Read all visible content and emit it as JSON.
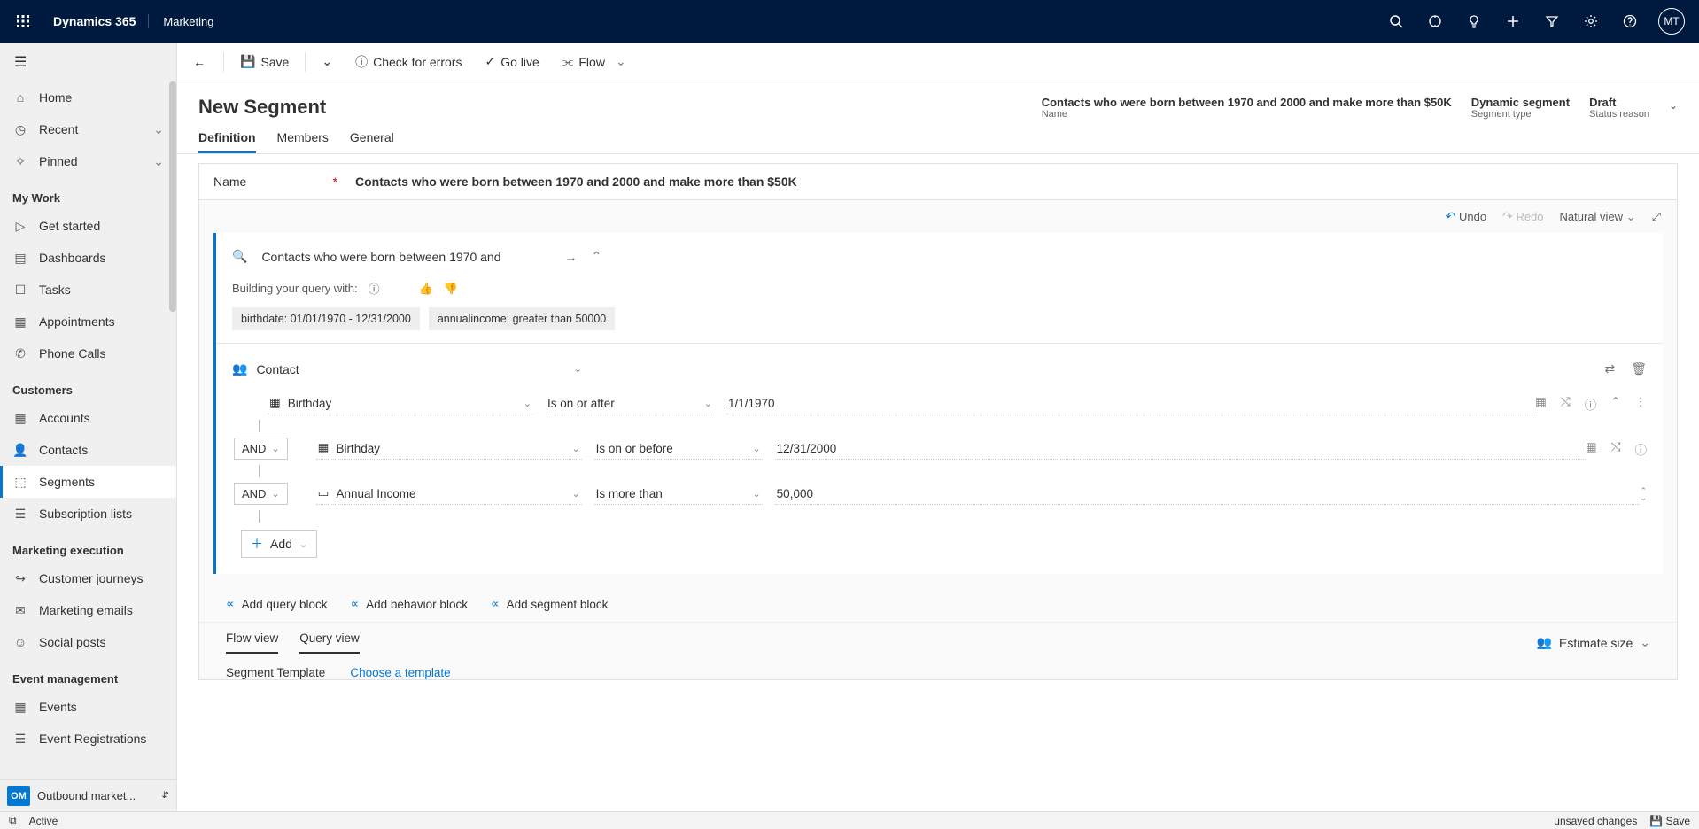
{
  "topbar": {
    "brand": "Dynamics 365",
    "area": "Marketing",
    "avatar": "MT"
  },
  "sidebar": {
    "top": [
      {
        "icon": "⌂",
        "label": "Home"
      },
      {
        "icon": "◷",
        "label": "Recent",
        "caret": true
      },
      {
        "icon": "📌",
        "label": "Pinned",
        "caret": true
      }
    ],
    "sections": [
      {
        "title": "My Work",
        "items": [
          {
            "icon": "▷",
            "label": "Get started"
          },
          {
            "icon": "▤",
            "label": "Dashboards"
          },
          {
            "icon": "☐",
            "label": "Tasks"
          },
          {
            "icon": "▦",
            "label": "Appointments"
          },
          {
            "icon": "✆",
            "label": "Phone Calls"
          }
        ]
      },
      {
        "title": "Customers",
        "items": [
          {
            "icon": "▦",
            "label": "Accounts"
          },
          {
            "icon": "👤",
            "label": "Contacts"
          },
          {
            "icon": "⬚",
            "label": "Segments",
            "active": true
          },
          {
            "icon": "☰",
            "label": "Subscription lists"
          }
        ]
      },
      {
        "title": "Marketing execution",
        "items": [
          {
            "icon": "↬",
            "label": "Customer journeys"
          },
          {
            "icon": "✉",
            "label": "Marketing emails"
          },
          {
            "icon": "☺",
            "label": "Social posts"
          }
        ]
      },
      {
        "title": "Event management",
        "items": [
          {
            "icon": "▦",
            "label": "Events"
          },
          {
            "icon": "☰",
            "label": "Event Registrations"
          }
        ]
      }
    ],
    "areaSwitch": {
      "badge": "OM",
      "label": "Outbound market..."
    }
  },
  "cmd": {
    "save": "Save",
    "check": "Check for errors",
    "golive": "Go live",
    "flow": "Flow"
  },
  "header": {
    "title": "New Segment",
    "name": {
      "val": "Contacts who were born between 1970 and 2000 and make more than $50K",
      "lbl": "Name"
    },
    "type": {
      "val": "Dynamic segment",
      "lbl": "Segment type"
    },
    "status": {
      "val": "Draft",
      "lbl": "Status reason"
    }
  },
  "tabs": [
    "Definition",
    "Members",
    "General"
  ],
  "nameField": {
    "label": "Name",
    "value": "Contacts who were born between 1970 and 2000 and make more than $50K"
  },
  "toolbar2": {
    "undo": "Undo",
    "redo": "Redo",
    "view": "Natural view"
  },
  "suggest": {
    "text": "Contacts who were born between 1970 and ",
    "buildlabel": "Building your query with:",
    "chip1": "birthdate: 01/01/1970 - 12/31/2000",
    "chip2": "annualincome: greater than 50000"
  },
  "entity": "Contact",
  "rows": [
    {
      "field": "Birthday",
      "op": "Is on or after",
      "val": "1/1/1970",
      "icons": [
        "cal",
        "shuf",
        "info",
        "up",
        "more"
      ]
    },
    {
      "and": "AND",
      "field": "Birthday",
      "op": "Is on or before",
      "val": "12/31/2000",
      "icons": [
        "cal",
        "shuf",
        "info"
      ]
    },
    {
      "and": "AND",
      "field": "Annual Income",
      "op": "Is more than",
      "val": "50,000",
      "icons": [
        "step"
      ]
    }
  ],
  "add": "Add",
  "blocks": {
    "q": "Add query block",
    "b": "Add behavior block",
    "s": "Add segment block"
  },
  "views": {
    "flow": "Flow view",
    "query": "Query view",
    "est": "Estimate size"
  },
  "tmpl": {
    "lbl": "Segment Template",
    "link": "Choose a template"
  },
  "status": {
    "active": "Active",
    "unsaved": "unsaved changes",
    "save": "Save"
  }
}
